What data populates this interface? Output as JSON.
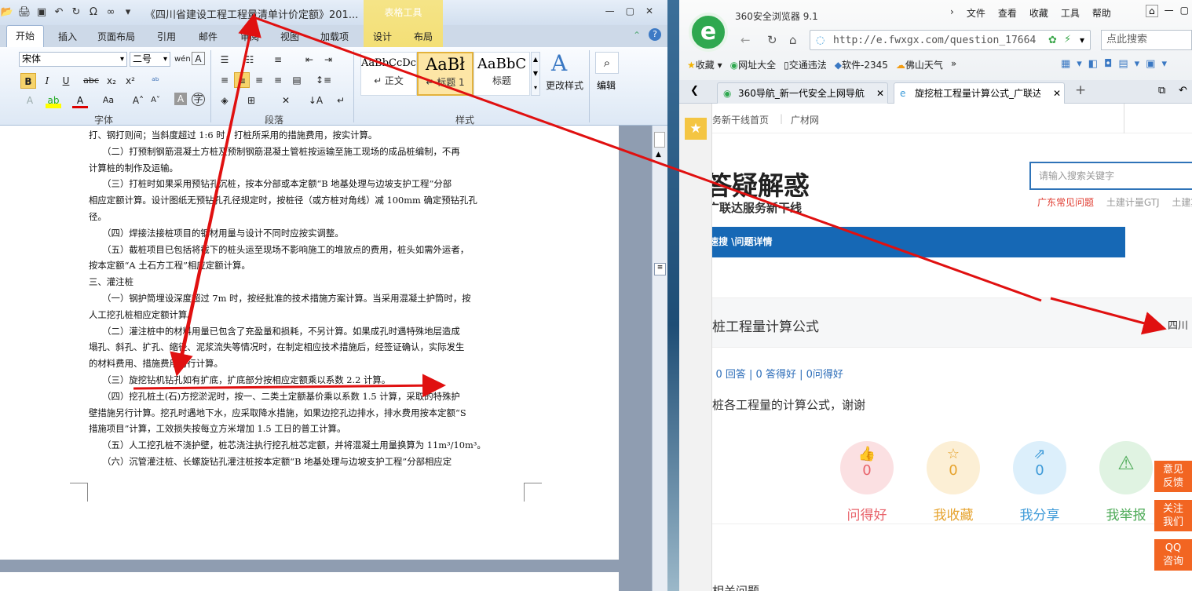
{
  "word": {
    "doc_title": "《四川省建设工程工程量清单计价定额》201...",
    "context_tab": "表格工具",
    "tabs": [
      "开始",
      "插入",
      "页面布局",
      "引用",
      "邮件",
      "审阅",
      "视图",
      "加载项",
      "设计",
      "布局"
    ],
    "font_name": "宋体",
    "font_size": "二号",
    "groups": {
      "font": "字体",
      "paragraph": "段落",
      "styles": "样式"
    },
    "styles": [
      {
        "preview": "AaBbCcDc",
        "label": "↵ 正文"
      },
      {
        "preview": "AaBł",
        "label": "↵ 标题 1"
      },
      {
        "preview": "AaBbC",
        "label": "标题"
      }
    ],
    "change_styles": "更改样式",
    "edit": "编辑",
    "paragraphs": [
      "打、钢打则间；当斜度超过 1:6 时，打桩所采用的措施费用，按实计算。",
      "　　（二）打预制钢筋混凝土方桩及预制钢筋混凝土管桩按运输至施工现场的成品桩编制，不再",
      "计算桩的制作及运输。",
      "　　（三）打桩时如果采用预钻孔沉桩，按本分部或本定额“B 地基处理与边坡支护工程”分部",
      "相应定额计算。设计图纸无预钻孔孔径规定时，按桩径（或方桩对角线）减 100mm 确定预钻孔孔",
      "径。",
      "　　（四）焊接法接桩项目的钢材用量与设计不同时应按实调整。",
      "　　（五）截桩项目已包括将截下的桩头运至现场不影响施工的堆放点的费用，桩头如需外运者，",
      "按本定额“A 土石方工程”相应定额计算。",
      "三、灌注桩",
      "　　（一）钢护筒埋设深度超过 7m 时，按经批准的技术措施方案计算。当采用混凝土护筒时，按",
      "人工挖孔桩相应定额计算。",
      "　　（二）灌注桩中的材料用量已包含了充盈量和损耗，不另计算。如果成孔时遇特殊地层造成",
      "塌孔、斜孔、扩孔、缩径、泥浆流失等情况时，在制定相应技术措施后，经签证确认，实际发生",
      "的材料费用、措施费用另行计算。",
      "　　（三）旋挖钻机钻孔如有扩底，扩底部分按相应定额乘以系数 2.2 计算。",
      "　　（四）挖孔桩土(石)方挖淤泥时，按一、二类土定额基价乘以系数 1.5 计算，采取的特殊护",
      "壁措施另行计算。挖孔时遇地下水，应采取降水措施，如果边挖孔边排水，排水费用按本定额“S",
      "措施项目”计算，工效损失按每立方米增加 1.5 工日的普工计算。",
      "　　（五）人工挖孔桩不浇护壁，桩芯浇注执行挖孔桩芯定额，并将混凝土用量换算为 11m³/10m³。",
      "　　（六）沉管灌注桩、长螺旋钻孔灌注桩按本定额“B 地基处理与边坡支护工程”分部相应定"
    ]
  },
  "browser": {
    "title": "360安全浏览器 9.1",
    "menu": [
      "文件",
      "查看",
      "收藏",
      "工具",
      "帮助"
    ],
    "url": "http://e.fwxgx.com/question_17664",
    "search_placeholder": "点此搜索",
    "bookmarks": [
      "收藏",
      "网址大全",
      "交通违法",
      "软件-2345",
      "佛山天气"
    ],
    "tabs": [
      "360导航_新一代安全上网导航",
      "旋挖桩工程量计算公式_广联达服"
    ],
    "site_nav": [
      "务新干线首页",
      "广材网"
    ],
    "banner_title": "答疑解惑",
    "banner_sub": "广联达服务新干线",
    "site_search_placeholder": "请输入搜索关键字",
    "hot_links": [
      "广东常见问题",
      "土建计量GTJ",
      "土建算"
    ],
    "breadcrumb": "速搜 \\问题详情",
    "question_title": "桩工程量计算公式",
    "region": "四川",
    "stats": "| 0 回答 | 0 答得好 | 0问得好",
    "question_body": "桩各工程量的计算公式，谢谢",
    "actions": [
      {
        "label": "问得好",
        "count": "0",
        "color": "#e8636b",
        "bg": "#fbe0e2"
      },
      {
        "label": "我收藏",
        "count": "0",
        "color": "#e6a32e",
        "bg": "#fcefd5"
      },
      {
        "label": "我分享",
        "count": "0",
        "color": "#3d9ad8",
        "bg": "#dceffb"
      },
      {
        "label": "我举报",
        "count": "",
        "color": "#4daa57",
        "bg": "#e0f3e2"
      }
    ],
    "float_btns": [
      "意见\n反馈",
      "关注\n我们",
      "QQ\n咨询"
    ],
    "footer_fragment": "相关问题"
  }
}
